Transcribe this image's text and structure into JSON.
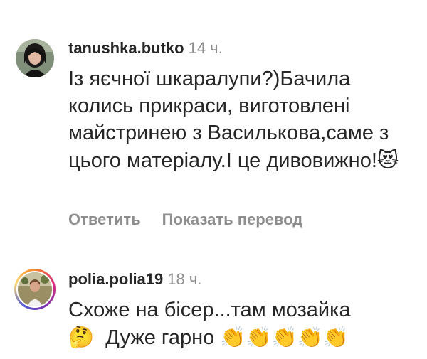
{
  "comments": [
    {
      "username": "tanushka.butko",
      "time": "14 ч.",
      "text": "Із яєчної шкаралупи?)Бачила колись прикраси, виготовлені майстринею з Василькова,саме з цього матеріалу.І це дивовижно!",
      "emoji_after": "😻",
      "reply_label": "Ответить",
      "translate_label": "Показать перевод"
    },
    {
      "username": "polia.polia19",
      "time": "18 ч.",
      "text_part1": "Схоже на бісер...там мозайка",
      "emoji_think": "🤔",
      "text_part2": "Дуже гарно",
      "emoji_clap": "👏👏👏👏👏"
    }
  ]
}
